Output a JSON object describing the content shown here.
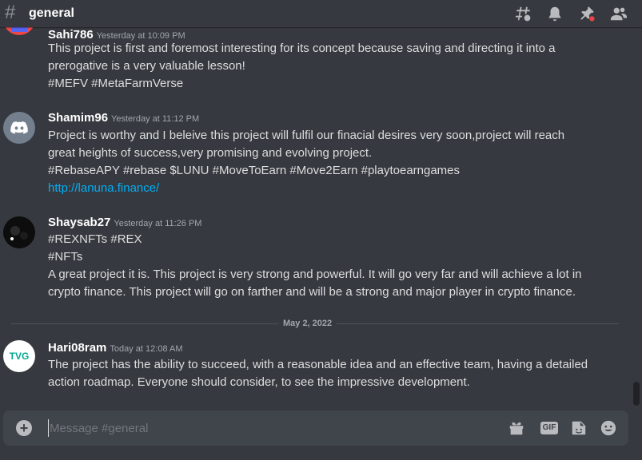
{
  "channel": {
    "hash_symbol": "#",
    "name": "general"
  },
  "header_icons": [
    "threads-icon",
    "bell-icon",
    "pin-icon",
    "members-icon"
  ],
  "messages": [
    {
      "username": "Sahi786",
      "timestamp": "Yesterday at 10:09 PM",
      "avatar_color": "#f04747",
      "lines": [
        "This project is first and foremost interesting for its concept because saving and directing it into a",
        "prerogative is a very valuable lesson!",
        "#MEFV #MetaFarmVerse"
      ]
    },
    {
      "username": "Shamim96",
      "timestamp": "Yesterday at 11:12 PM",
      "avatar_color": "#747f8d",
      "lines": [
        "Project is worthy and I beleive this project will fulfil our finacial desires very soon,project will reach",
        "great heights of success,very promising and evolving project.",
        "#RebaseAPY #rebase $LUNU #MoveToEarn #Move2Earn #playtoearngames"
      ],
      "link": "http://lanuna.finance/"
    },
    {
      "username": "Shaysab27",
      "timestamp": "Yesterday at 11:26 PM",
      "avatar_color": "#0d0d0d",
      "lines": [
        "#REXNFTs #REX",
        "#NFTs",
        "A great project it is.  This project is very strong and powerful. It will go very far and will achieve a lot in",
        "crypto finance. This project will go on farther and will be a strong and major player in crypto finance."
      ]
    },
    {
      "username": "Hari08ram",
      "timestamp": "Today at 12:08 AM",
      "avatar_color": "#ffffff",
      "avatar_text": "TVG",
      "lines": [
        "The project has the ability to succeed, with a reasonable idea and an effective team, having a detailed",
        "action roadmap. Everyone should consider, to see the impressive development."
      ]
    }
  ],
  "date_divider": "May 2, 2022",
  "composer": {
    "placeholder": "Message #general",
    "icons": [
      "add-icon",
      "gift-icon",
      "gif-icon",
      "sticker-icon",
      "emoji-icon"
    ],
    "gif_label": "GIF"
  },
  "colors": {
    "background": "#36393f",
    "composer": "#40444b",
    "link": "#00aff4",
    "username": "#ffffff",
    "text": "#dcddde"
  }
}
